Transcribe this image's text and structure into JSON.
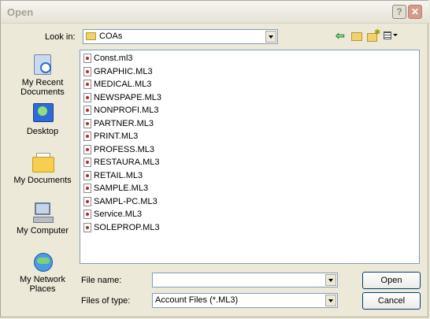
{
  "window": {
    "title": "Open",
    "help_glyph": "?",
    "close_glyph": "✕"
  },
  "lookin": {
    "label": "Look in:",
    "value": "COAs"
  },
  "toolbar": {
    "back_glyph": "⇦"
  },
  "places": [
    {
      "label": "My Recent Documents",
      "icon": "recent-documents-icon"
    },
    {
      "label": "Desktop",
      "icon": "desktop-icon"
    },
    {
      "label": "My Documents",
      "icon": "my-documents-icon"
    },
    {
      "label": "My Computer",
      "icon": "my-computer-icon"
    },
    {
      "label": "My Network Places",
      "icon": "network-places-icon"
    }
  ],
  "files": [
    "Const.ml3",
    "GRAPHIC.ML3",
    "MEDICAL.ML3",
    "NEWSPAPE.ML3",
    "NONPROFI.ML3",
    "PARTNER.ML3",
    "PRINT.ML3",
    "PROFESS.ML3",
    "RESTAURA.ML3",
    "RETAIL.ML3",
    "SAMPLE.ML3",
    "SAMPL-PC.ML3",
    "Service.ML3",
    "SOLEPROP.ML3"
  ],
  "filename": {
    "label": "File name:",
    "value": ""
  },
  "filetype": {
    "label": "Files of type:",
    "value": "Account Files (*.ML3)"
  },
  "buttons": {
    "open": "Open",
    "cancel": "Cancel"
  }
}
